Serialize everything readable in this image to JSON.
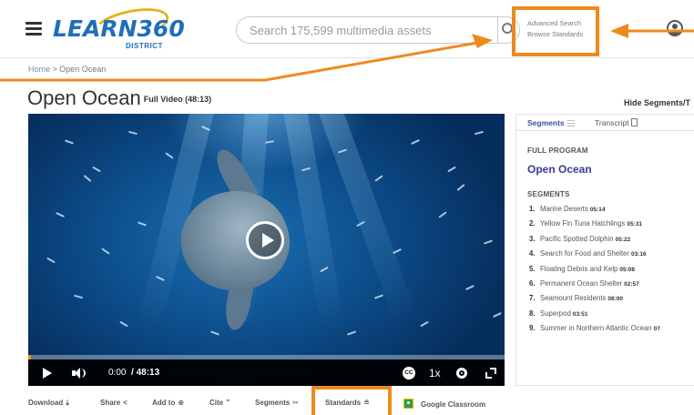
{
  "header": {
    "logo_text": "LEARN360",
    "logo_subtext": "DISTRICT",
    "search_placeholder": "Search 175,599 multimedia assets",
    "advanced_search": "Advanced Search",
    "browse_standards": "Browse Standards"
  },
  "breadcrumb": {
    "home": "Home",
    "separator": " > ",
    "current": "Open Ocean"
  },
  "title": {
    "main": "Open Ocean",
    "meta": "Full Video (48:13)",
    "hide_segments": "Hide Segments/T"
  },
  "player": {
    "current_time": "0:00",
    "duration": "/ 48:13",
    "cc_label": "CC",
    "speed": "1x",
    "progress": 0.005
  },
  "panel": {
    "tab_segments": "Segments",
    "tab_transcript": "Transcript",
    "full_program_label": "FULL PROGRAM",
    "program_title": "Open Ocean",
    "segments_label": "SEGMENTS",
    "segments": [
      {
        "num": "1.",
        "title": "Marine Deserts",
        "time": "05:14"
      },
      {
        "num": "2.",
        "title": "Yellow Fin Tuna Hatchlings",
        "time": "05:31"
      },
      {
        "num": "3.",
        "title": "Pacific Spotted Dolphin",
        "time": "05:22"
      },
      {
        "num": "4.",
        "title": "Search for Food and Shelter",
        "time": "03:16"
      },
      {
        "num": "5.",
        "title": "Floating Debris and Kelp",
        "time": "05:08"
      },
      {
        "num": "6.",
        "title": "Permanent Ocean Shelter",
        "time": "02:57"
      },
      {
        "num": "7.",
        "title": "Seamount Residents",
        "time": "08:00"
      },
      {
        "num": "8.",
        "title": "Superpod",
        "time": "03:51"
      },
      {
        "num": "9.",
        "title": "Summer in Northern Atlantic Ocean",
        "time": "07"
      }
    ]
  },
  "toolbar": {
    "download": "Download",
    "share": "Share",
    "add_to": "Add to",
    "cite": "Cite",
    "segments": "Segments",
    "standards": "Standards",
    "google_classroom": "Google Classroom"
  },
  "colors": {
    "annotation": "#ee8a1d",
    "link_blue": "#3b3b96",
    "brand_blue": "#1f6fb8"
  },
  "icons": {
    "menu": "hamburger-icon",
    "search": "search-icon",
    "account": "account-icon",
    "play": "play-icon",
    "volume": "volume-icon",
    "settings": "gear-icon",
    "fullscreen": "fullscreen-icon",
    "closed_captions": "cc-icon",
    "classroom": "google-classroom-icon"
  }
}
